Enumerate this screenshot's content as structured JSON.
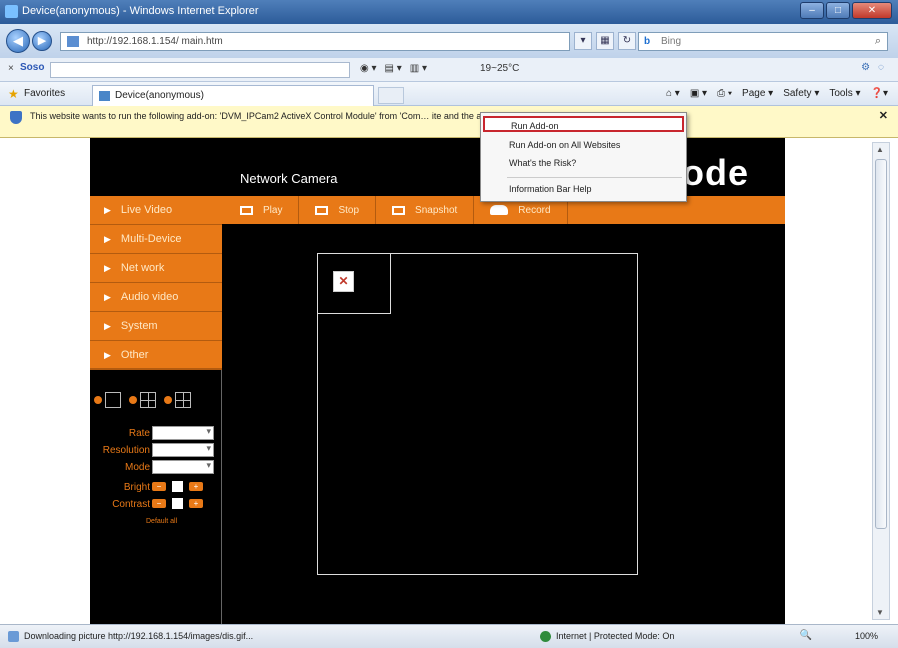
{
  "window": {
    "title": "Device(anonymous) - Windows Internet Explorer"
  },
  "address_bar": {
    "url": "http://192.168.1.154/ main.htm",
    "search_placeholder": "Bing"
  },
  "toolbar": {
    "soso_label": "Soso",
    "weather": "19~25°C"
  },
  "favorites_bar": {
    "favorites_label": "Favorites",
    "tab_title": "Device(anonymous)",
    "commands": [
      "Page ▾",
      "Safety ▾",
      "Tools ▾"
    ]
  },
  "info_bar": {
    "text": "This website wants to run the following add-on: 'DVM_IPCam2 ActiveX Control Module' from 'Com… ite and the add-on and want to allow it to run, click here..."
  },
  "context_menu": {
    "items": [
      "Run Add-on",
      "Run Add-on on All Websites",
      "What's the Risk?",
      "Information Bar Help"
    ]
  },
  "camera_page": {
    "header_title": "Network Camera",
    "brand": "ode",
    "menu": [
      "Live Video",
      "Multi-Device",
      "Net work",
      "Audio video",
      "System",
      "Other"
    ],
    "controls": [
      "Play",
      "Stop",
      "Snapshot",
      "Record"
    ],
    "form": {
      "rate_label": "Rate",
      "resolution_label": "Resolution",
      "mode_label": "Mode",
      "bright_label": "Bright",
      "contrast_label": "Contrast",
      "default_link": "Default all"
    }
  },
  "status_bar": {
    "text": "Downloading picture http://192.168.1.154/images/dis.gif...",
    "zone": "Internet | Protected Mode: On",
    "zoom": "100%"
  }
}
